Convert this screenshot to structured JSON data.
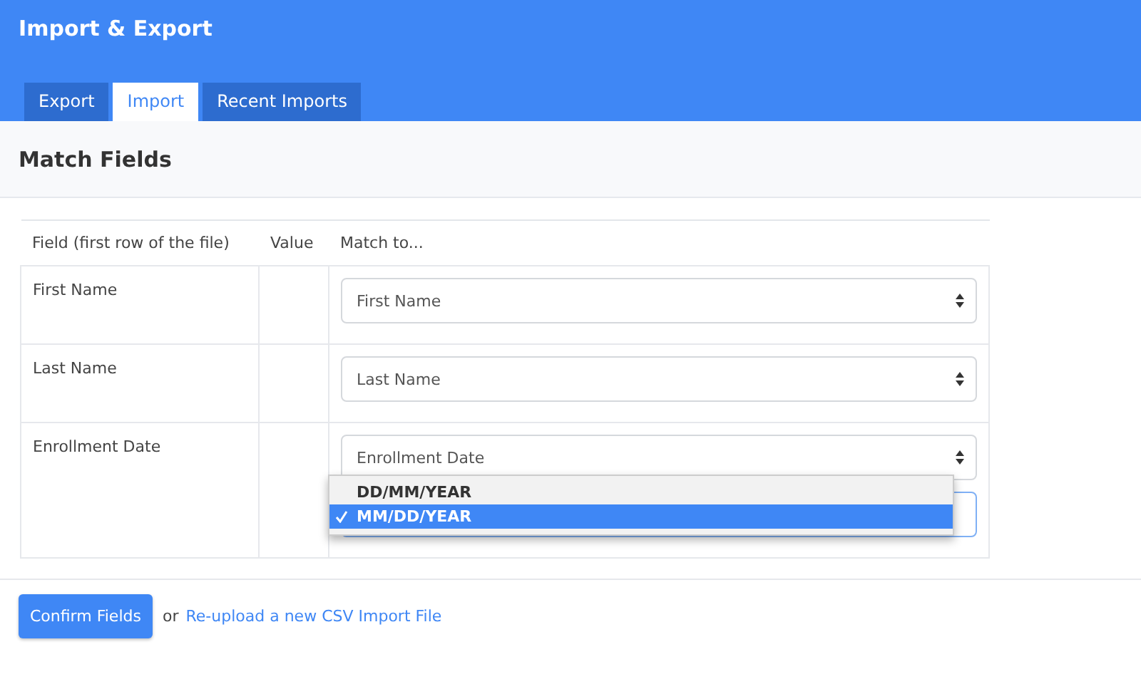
{
  "header": {
    "title": "Import & Export"
  },
  "tabs": [
    {
      "label": "Export",
      "selected": false
    },
    {
      "label": "Import",
      "selected": true
    },
    {
      "label": "Recent Imports",
      "selected": false
    }
  ],
  "section": {
    "title": "Match Fields"
  },
  "table": {
    "columns": [
      "Field (first row of the file)",
      "Value",
      "Match to..."
    ],
    "rows": [
      {
        "field": "First Name",
        "selects": [
          {
            "value": "First Name"
          }
        ]
      },
      {
        "field": "Last Name",
        "selects": [
          {
            "value": "Last Name"
          }
        ]
      },
      {
        "field": "Enrollment Date",
        "selects": [
          {
            "value": "Enrollment Date"
          },
          {
            "open": true,
            "options": [
              {
                "label": "DD/MM/YEAR",
                "selected": false
              },
              {
                "label": "MM/DD/YEAR",
                "selected": true
              }
            ]
          }
        ]
      }
    ]
  },
  "footer": {
    "button": "Confirm Fields",
    "joiner": "or",
    "link": "Re-upload a new CSV Import File"
  }
}
